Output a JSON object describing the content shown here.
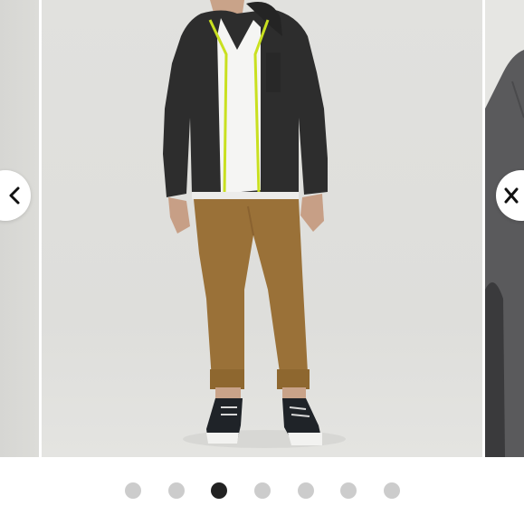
{
  "carousel": {
    "current_index": 3,
    "total_slides": 7,
    "prev_icon": "chevron-left-icon",
    "next_icon": "close-icon",
    "colors": {
      "active_dot": "#222222",
      "inactive_dot": "#cccccc",
      "background": "#ffffff"
    }
  }
}
